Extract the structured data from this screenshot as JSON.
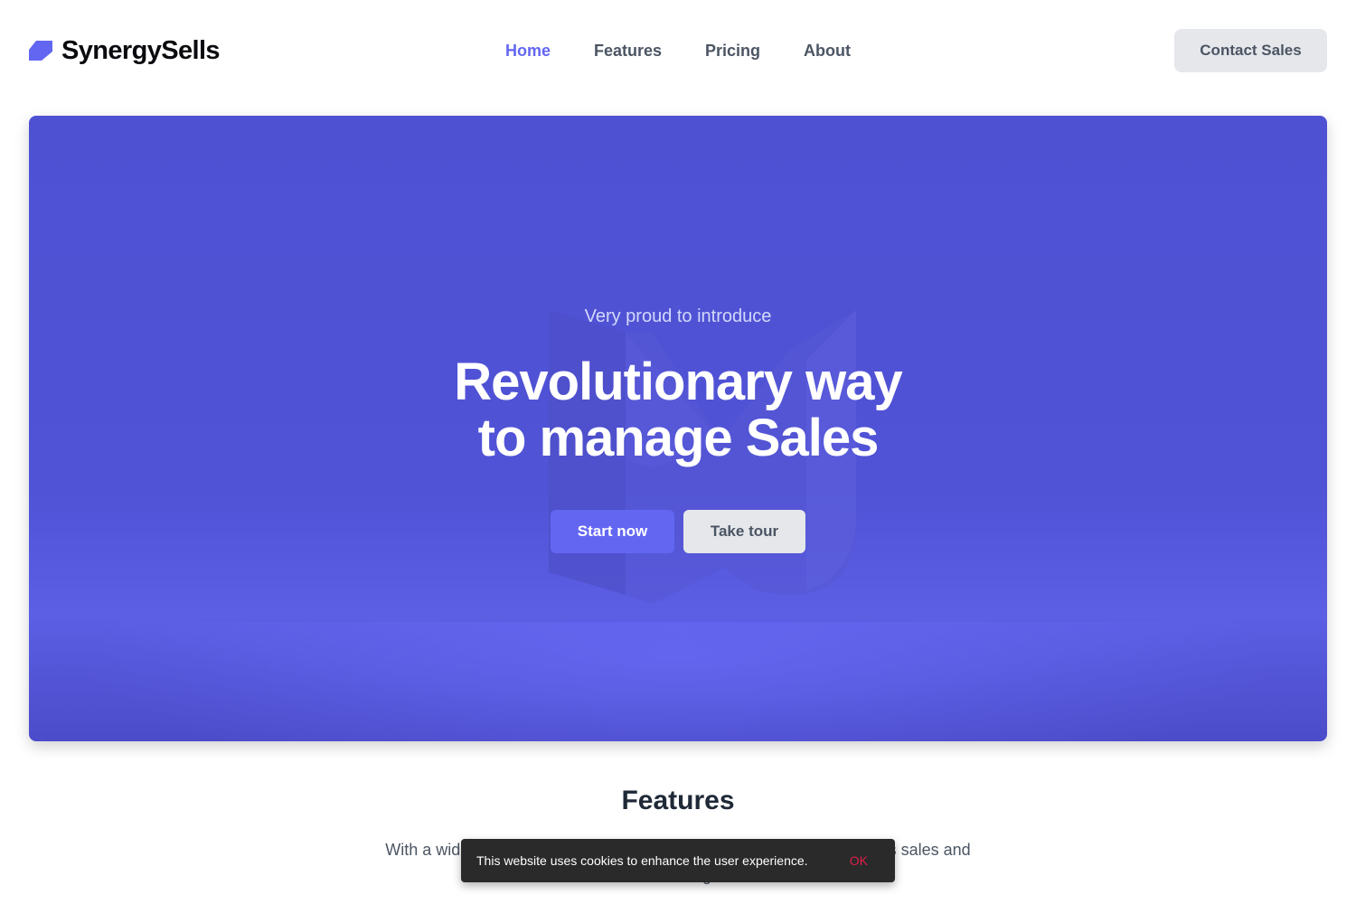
{
  "brand": {
    "name": "SynergySells",
    "icon": "parallelogram-logo-icon",
    "accent_color": "#6366f1"
  },
  "nav": {
    "items": [
      {
        "label": "Home",
        "active": true
      },
      {
        "label": "Features",
        "active": false
      },
      {
        "label": "Pricing",
        "active": false
      },
      {
        "label": "About",
        "active": false
      }
    ],
    "cta_label": "Contact Sales"
  },
  "hero": {
    "eyebrow": "Very proud to introduce",
    "title_line1": "Revolutionary way",
    "title_line2": "to manage Sales",
    "primary_label": "Start now",
    "secondary_label": "Take tour",
    "background_color": "#5053d6"
  },
  "features": {
    "title": "Features",
    "description": "With a wide range of tools to help you grow and manage your business sales and marketing."
  },
  "cookie": {
    "message": "This website uses cookies to enhance the user experience.",
    "ok_label": "OK",
    "ok_color": "#e11d48"
  }
}
